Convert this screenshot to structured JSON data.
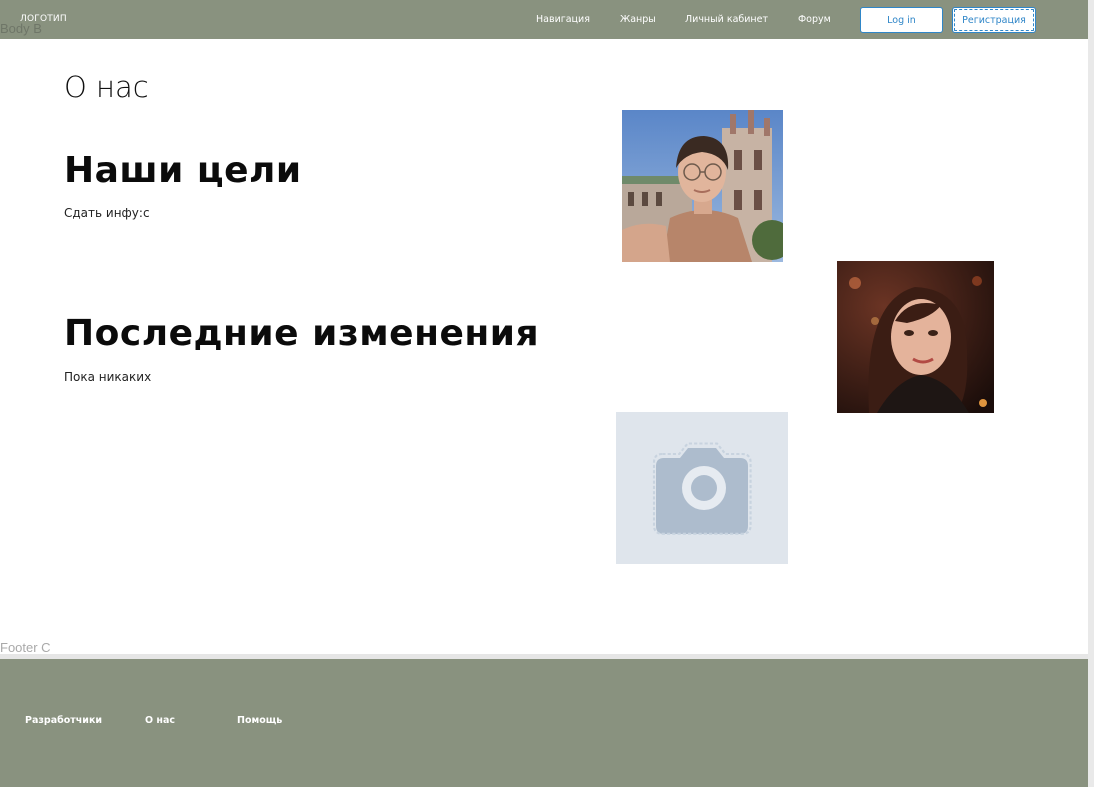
{
  "header": {
    "logo": "ЛОГОТИП",
    "nav": [
      "Навигация",
      "Жанры",
      "Личный кабинет",
      "Форум"
    ],
    "login_label": "Log in",
    "register_label": "Регистрация",
    "frame_label": "Body B"
  },
  "main": {
    "about_title": "О нас",
    "goals_heading": "Наши цели",
    "goals_text": "Сдать инфу:с",
    "changes_heading": "Последние изменения",
    "changes_text": "Пока никаких"
  },
  "footer": {
    "frame_label": "Footer C",
    "links": [
      "Разработчики",
      "О нас",
      "Помощь"
    ]
  },
  "colors": {
    "header_bg": "#89927f",
    "accent": "#2f86c8"
  }
}
